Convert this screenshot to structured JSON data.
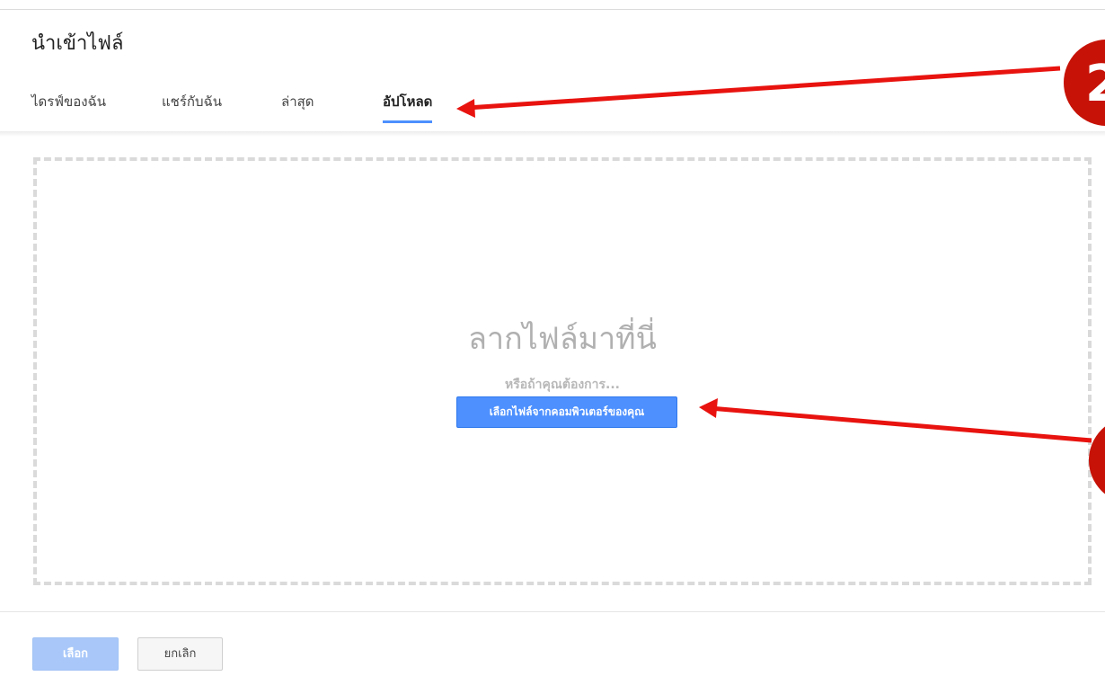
{
  "dialog": {
    "title": "นำเข้าไฟล์"
  },
  "tabs": [
    {
      "label": "ไดรฟ์ของฉัน",
      "active": false
    },
    {
      "label": "แชร์กับฉัน",
      "active": false
    },
    {
      "label": "ล่าสุด",
      "active": false
    },
    {
      "label": "อัปโหลด",
      "active": true
    }
  ],
  "upload": {
    "drop_title": "ลากไฟล์มาที่นี่",
    "or_text": "หรือถ้าคุณต้องการ...",
    "pick_button_label": "เลือกไฟล์จากคอมพิวเตอร์ของคุณ"
  },
  "footer": {
    "select_label": "เลือก",
    "cancel_label": "ยกเลิก"
  },
  "annotations": {
    "marker_top_label": "2",
    "arrow_color": "#e8130f",
    "marker_color": "#c71207"
  },
  "colors": {
    "accent": "#4d90fe",
    "active_tab_underline": "#4d90fe",
    "dropzone_border": "#dadada",
    "disabled_primary": "#a9c8f9"
  }
}
